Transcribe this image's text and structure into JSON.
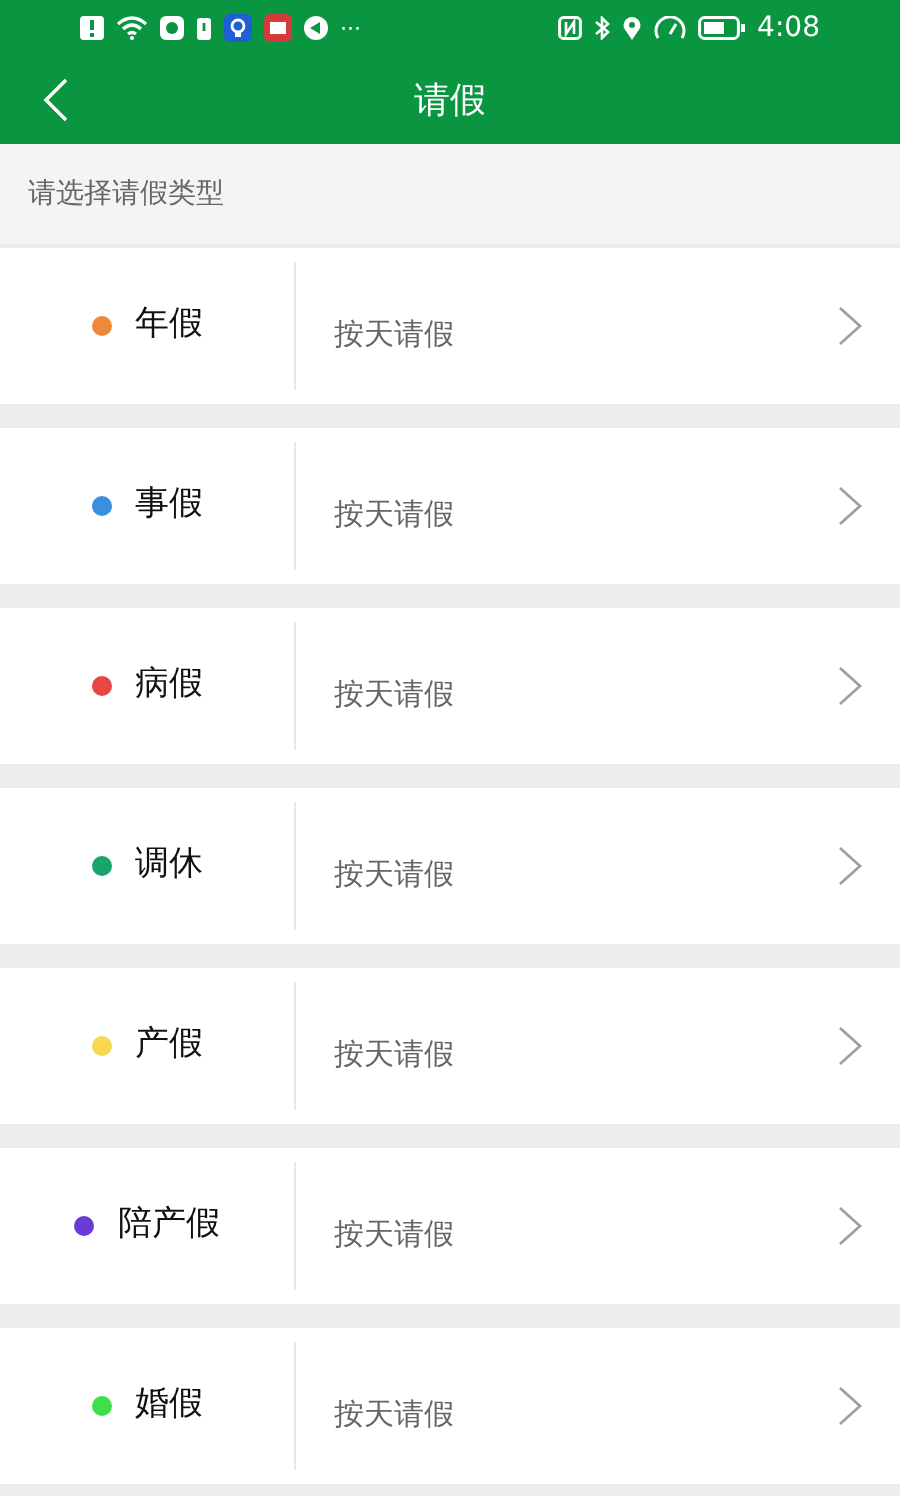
{
  "status_bar": {
    "more": "···",
    "time": "4:08"
  },
  "header": {
    "title": "请假"
  },
  "section_label": "请选择请假类型",
  "leave_types": [
    {
      "name": "年假",
      "color": "#f0883a",
      "mode": "按天请假"
    },
    {
      "name": "事假",
      "color": "#3a8fe0",
      "mode": "按天请假"
    },
    {
      "name": "病假",
      "color": "#e84545",
      "mode": "按天请假"
    },
    {
      "name": "调休",
      "color": "#17a56b",
      "mode": "按天请假"
    },
    {
      "name": "产假",
      "color": "#f7d84e",
      "mode": "按天请假"
    },
    {
      "name": "陪产假",
      "color": "#6a3bd6",
      "mode": "按天请假"
    },
    {
      "name": "婚假",
      "color": "#3de04a",
      "mode": "按天请假"
    }
  ]
}
